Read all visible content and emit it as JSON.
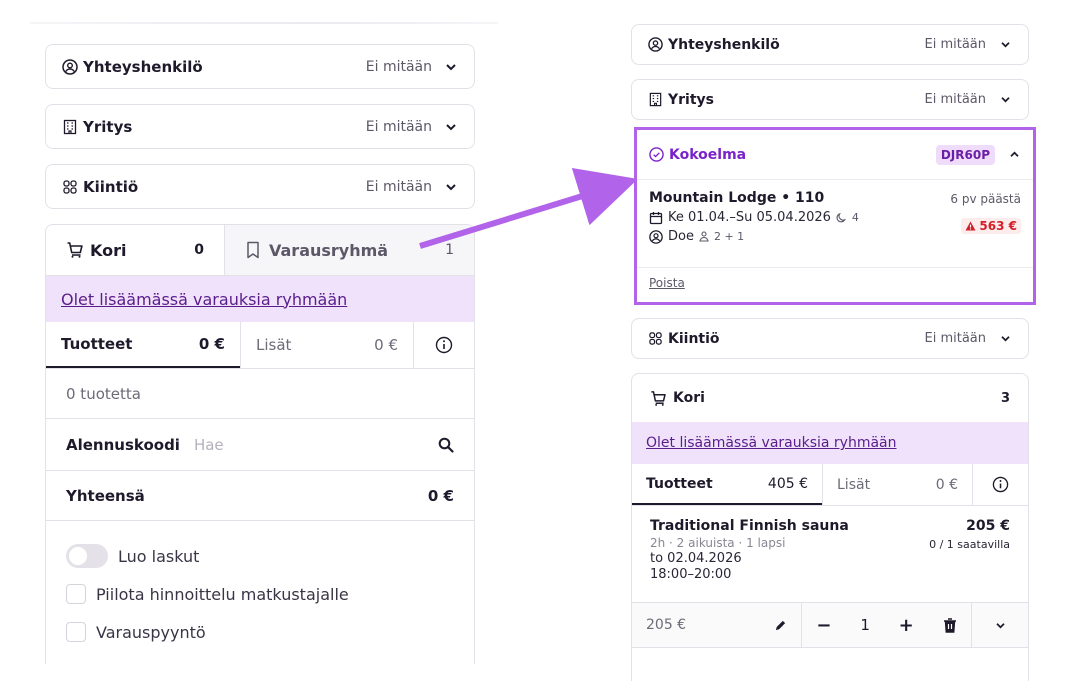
{
  "left": {
    "contact": {
      "title": "Yhteyshenkilö",
      "value": "Ei mitään"
    },
    "company": {
      "title": "Yritys",
      "value": "Ei mitään"
    },
    "quota": {
      "title": "Kiintiö",
      "value": "Ei mitään"
    },
    "cart_tab": {
      "label": "Kori",
      "count": "0"
    },
    "group_tab": {
      "label": "Varausryhmä",
      "count": "1"
    },
    "banner": "Olet lisäämässä varauksia ryhmään",
    "products_tab": {
      "label": "Tuotteet",
      "amount": "0 €"
    },
    "extras_tab": {
      "label": "Lisät",
      "amount": "0 €"
    },
    "empty_text": "0 tuotetta",
    "discount": {
      "label": "Alennuskoodi",
      "placeholder": "Hae"
    },
    "total": {
      "label": "Yhteensä",
      "amount": "0 €"
    },
    "options": {
      "invoices": "Luo laskut",
      "hide_pricing": "Piilota hinnoittelu matkustajalle",
      "request": "Varauspyyntö"
    }
  },
  "right": {
    "contact": {
      "title": "Yhteyshenkilö",
      "value": "Ei mitään"
    },
    "company": {
      "title": "Yritys",
      "value": "Ei mitään"
    },
    "collection": {
      "title": "Kokoelma",
      "code": "DJR60P",
      "name": "Mountain Lodge • 110",
      "dates": "Ke 01.04.–Su 05.04.2026",
      "nights": "4",
      "guest": "Doe",
      "people": "2 + 1",
      "when": "6 pv päästä",
      "alert": "563 €",
      "remove": "Poista"
    },
    "quota": {
      "title": "Kiintiö",
      "value": "Ei mitään"
    },
    "cart": {
      "label": "Kori",
      "count": "3"
    },
    "banner": "Olet lisäämässä varauksia ryhmään",
    "products_tab": {
      "label": "Tuotteet",
      "amount": "405 €"
    },
    "extras_tab": {
      "label": "Lisät",
      "amount": "0 €"
    },
    "item": {
      "name": "Traditional Finnish sauna",
      "meta": "2h  ·  2 aikuista  ·  1 lapsi",
      "date": "to 02.04.2026",
      "time": "18:00–20:00",
      "price": "205 €",
      "availability": "0 / 1 saatavilla",
      "line_price": "205 €",
      "qty": "1"
    }
  },
  "colors": {
    "accent": "#7c22c9",
    "highlight_border": "#b163ea",
    "banner_bg": "#efe2fa",
    "alert": "#d2202b"
  }
}
